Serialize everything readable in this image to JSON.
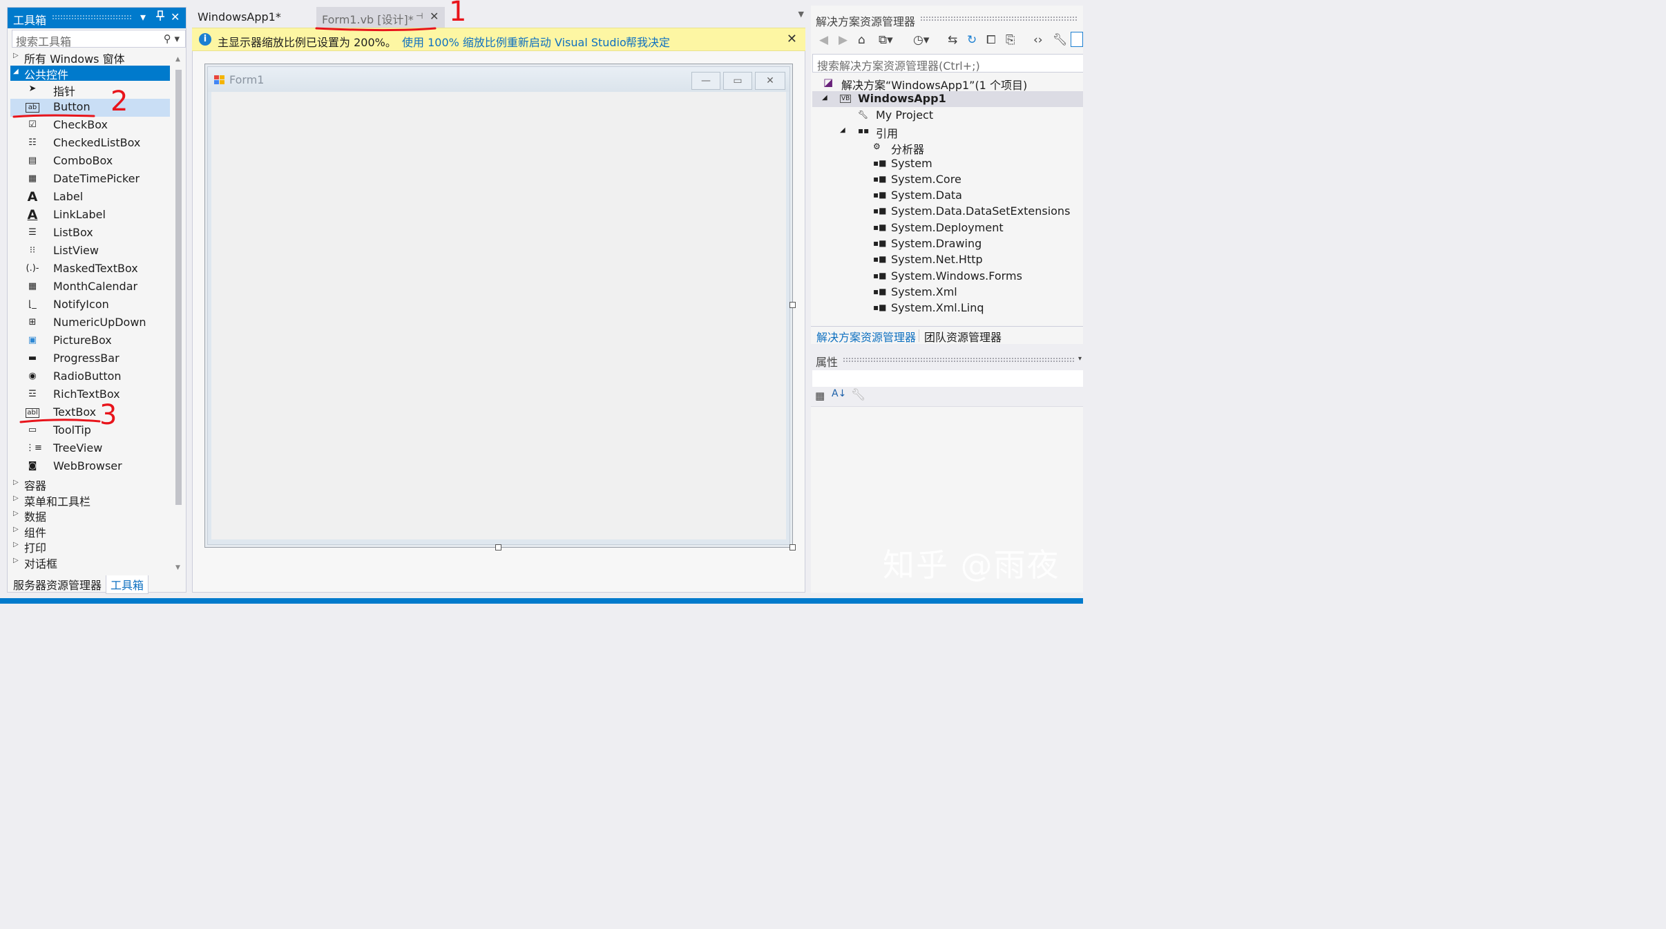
{
  "toolbox": {
    "title": "工具箱",
    "pin_icon": "pin-icon",
    "search_placeholder": "搜索工具箱",
    "categories_top": [
      {
        "label": "所有 Windows 窗体",
        "expanded": false
      },
      {
        "label": "公共控件",
        "expanded": true,
        "selected": true
      }
    ],
    "tools": [
      {
        "label": "指针",
        "icon": "pointer-icon"
      },
      {
        "label": "Button",
        "icon": "button-icon",
        "selected": true
      },
      {
        "label": "CheckBox",
        "icon": "checkbox-icon"
      },
      {
        "label": "CheckedListBox",
        "icon": "checkedlistbox-icon"
      },
      {
        "label": "ComboBox",
        "icon": "combobox-icon"
      },
      {
        "label": "DateTimePicker",
        "icon": "datetimepicker-icon"
      },
      {
        "label": "Label",
        "icon": "label-icon"
      },
      {
        "label": "LinkLabel",
        "icon": "linklabel-icon"
      },
      {
        "label": "ListBox",
        "icon": "listbox-icon"
      },
      {
        "label": "ListView",
        "icon": "listview-icon"
      },
      {
        "label": "MaskedTextBox",
        "icon": "maskedtextbox-icon"
      },
      {
        "label": "MonthCalendar",
        "icon": "monthcalendar-icon"
      },
      {
        "label": "NotifyIcon",
        "icon": "notifyicon-icon"
      },
      {
        "label": "NumericUpDown",
        "icon": "numericupdown-icon"
      },
      {
        "label": "PictureBox",
        "icon": "picturebox-icon"
      },
      {
        "label": "ProgressBar",
        "icon": "progressbar-icon"
      },
      {
        "label": "RadioButton",
        "icon": "radiobutton-icon"
      },
      {
        "label": "RichTextBox",
        "icon": "richtextbox-icon"
      },
      {
        "label": "TextBox",
        "icon": "textbox-icon"
      },
      {
        "label": "ToolTip",
        "icon": "tooltip-icon"
      },
      {
        "label": "TreeView",
        "icon": "treeview-icon"
      },
      {
        "label": "WebBrowser",
        "icon": "webbrowser-icon"
      }
    ],
    "categories_bottom": [
      {
        "label": "容器"
      },
      {
        "label": "菜单和工具栏"
      },
      {
        "label": "数据"
      },
      {
        "label": "组件"
      },
      {
        "label": "打印"
      },
      {
        "label": "对话框"
      }
    ],
    "bottom_tabs": [
      "服务器资源管理器",
      "工具箱"
    ]
  },
  "editor": {
    "tabs": [
      {
        "label": "WindowsApp1*",
        "active": false
      },
      {
        "label": "Form1.vb [设计]*",
        "active": true
      }
    ],
    "info_bar": {
      "message": "主显示器缩放比例已设置为 200%。",
      "link1": "使用 100% 缩放比例重新启动 Visual Studio",
      "link2": "帮我决定"
    },
    "form": {
      "title": "Form1"
    }
  },
  "solution_explorer": {
    "title": "解决方案资源管理器",
    "search_placeholder": "搜索解决方案资源管理器(Ctrl+;)",
    "tree": [
      {
        "label": "解决方案“WindowsApp1”(1 个项目)",
        "level": 0,
        "icon": "solution-icon"
      },
      {
        "label": "WindowsApp1",
        "level": 1,
        "icon": "vb-project-icon",
        "bold": true,
        "selected": true,
        "expanded": true
      },
      {
        "label": "My Project",
        "level": 2,
        "icon": "wrench-icon"
      },
      {
        "label": "引用",
        "level": 2,
        "icon": "references-icon",
        "expanded": true
      },
      {
        "label": "分析器",
        "level": 3,
        "icon": "analyzer-icon"
      },
      {
        "label": "System",
        "level": 3,
        "icon": "reference-icon"
      },
      {
        "label": "System.Core",
        "level": 3,
        "icon": "reference-icon"
      },
      {
        "label": "System.Data",
        "level": 3,
        "icon": "reference-icon"
      },
      {
        "label": "System.Data.DataSetExtensions",
        "level": 3,
        "icon": "reference-icon"
      },
      {
        "label": "System.Deployment",
        "level": 3,
        "icon": "reference-icon"
      },
      {
        "label": "System.Drawing",
        "level": 3,
        "icon": "reference-icon"
      },
      {
        "label": "System.Net.Http",
        "level": 3,
        "icon": "reference-icon"
      },
      {
        "label": "System.Windows.Forms",
        "level": 3,
        "icon": "reference-icon"
      },
      {
        "label": "System.Xml",
        "level": 3,
        "icon": "reference-icon"
      },
      {
        "label": "System.Xml.Linq",
        "level": 3,
        "icon": "reference-icon"
      }
    ],
    "bottom_tabs": [
      "解决方案资源管理器",
      "团队资源管理器"
    ]
  },
  "properties": {
    "title": "属性"
  },
  "watermark": "知乎 @雨夜",
  "annotations": [
    "1",
    "2",
    "3"
  ],
  "colors": {
    "accent": "#007acc",
    "selection": "#c9def5",
    "info_bar": "#fdf6a3",
    "annotation": "#e8141b"
  }
}
